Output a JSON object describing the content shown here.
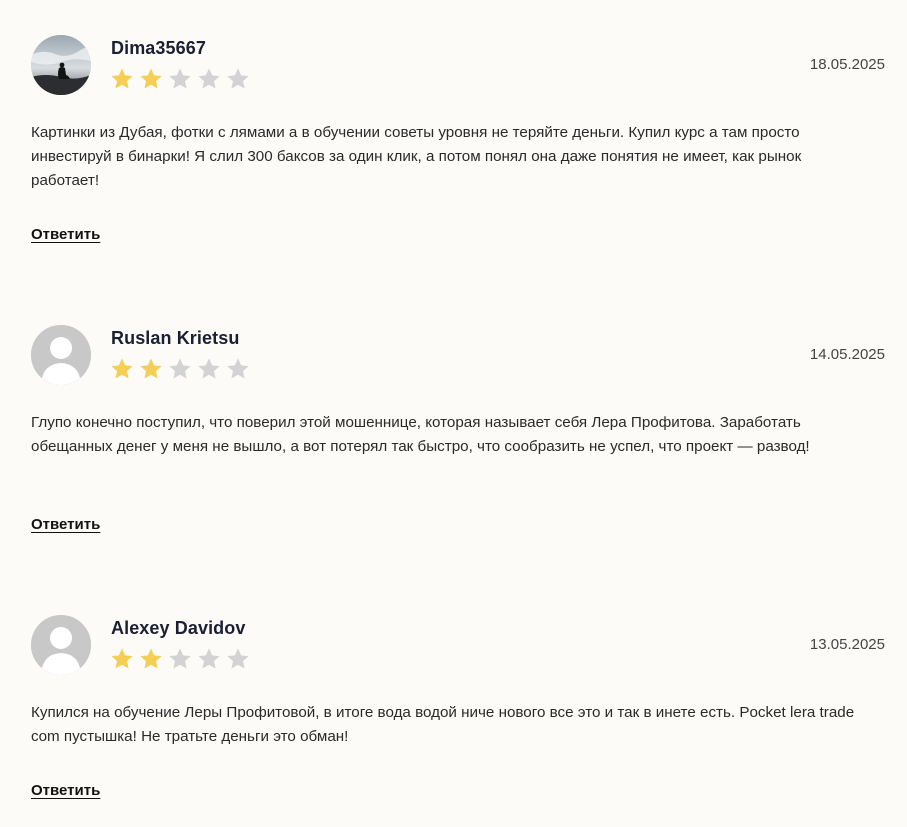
{
  "colors": {
    "background": "#fdfbf8",
    "star_filled": "#f5cf55",
    "star_empty": "#d3d3d3",
    "avatar_placeholder": "#c8c8c8"
  },
  "reviews": [
    {
      "author": "Dima35667",
      "date": "18.05.2025",
      "rating": 2,
      "max_rating": 5,
      "avatar": "photo-silhouette-avatar",
      "text": "Картинки из Дубая, фотки с лямами а в обучении советы уровня не теряйте деньги. Купил курс а там просто инвестируй в бинарки! Я слил 300 баксов за один клик, а потом понял она даже понятия не имеет, как рынок работает!",
      "reply_label": "Ответить"
    },
    {
      "author": "Ruslan Krietsu",
      "date": "14.05.2025",
      "rating": 2,
      "max_rating": 5,
      "avatar": "default-user-avatar",
      "text": "Глупо конечно поступил, что поверил этой мошеннице, которая называет себя Лера Профитова. Заработать обещанных денег у меня не вышло, а вот потерял так быстро, что сообразить не успел, что проект — развод!",
      "reply_label": "Ответить"
    },
    {
      "author": "Alexey Davidov",
      "date": "13.05.2025",
      "rating": 2,
      "max_rating": 5,
      "avatar": "default-user-avatar",
      "text": "Купился на обучение Леры Профитовой, в итоге вода водой ниче нового все это и так в инете есть. Pocket lera trade com пустышка! Не тратьте деньги это обман!",
      "reply_label": "Ответить"
    }
  ]
}
